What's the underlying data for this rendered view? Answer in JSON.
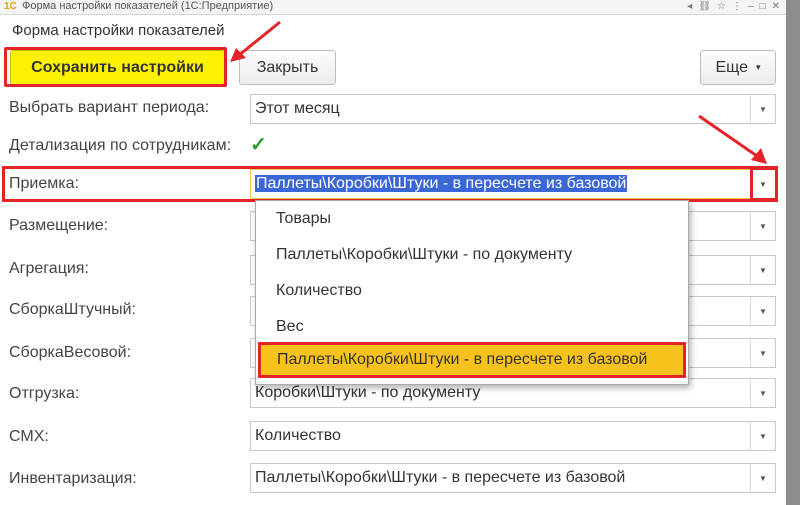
{
  "window": {
    "title": "Форма настройки показателей (1С:Предприятие)",
    "app_icon": "1c-logo-icon",
    "controls": [
      "back-icon",
      "link-icon",
      "star-icon",
      "menu-icon",
      "minimize-icon",
      "maximize-icon",
      "close-icon"
    ]
  },
  "form": {
    "title": "Форма настройки показателей"
  },
  "toolbar": {
    "save_label": "Сохранить настройки",
    "close_label": "Закрыть",
    "more_label": "Еще",
    "more_caret": "▾"
  },
  "fields": {
    "period": {
      "label": "Выбрать вариант периода:",
      "value": "Этот месяц"
    },
    "detail": {
      "label": "Детализация по сотрудникам:",
      "checked": true,
      "mark": "✓"
    },
    "priemka": {
      "label": "Приемка:",
      "value": "Паллеты\\Коробки\\Штуки - в пересчете из базовой"
    },
    "razmeshchenie": {
      "label": "Размещение:",
      "value": ""
    },
    "agregatsiya": {
      "label": "Агрегация:",
      "value": ""
    },
    "sborka_sht": {
      "label": "СборкаШтучный:",
      "value": ""
    },
    "sborka_ves": {
      "label": "СборкаВесовой:",
      "value": ""
    },
    "otgruzka": {
      "label": "Отгрузка:",
      "value": "Коробки\\Штуки - по документу"
    },
    "smh": {
      "label": "СМХ:",
      "value": "Количество"
    },
    "inventarizatsiya": {
      "label": "Инвентаризация:",
      "value": "Паллеты\\Коробки\\Штуки - в пересчете из базовой"
    }
  },
  "dropdown": {
    "options": [
      "Товары",
      "Паллеты\\Коробки\\Штуки - по документу",
      "Количество",
      "Вес",
      "Паллеты\\Коробки\\Штуки - в пересчете из базовой"
    ],
    "selected_index": 4
  },
  "colors": {
    "highlight": "#e5242a",
    "save_button": "#fff200",
    "selected_option": "#f6c21b",
    "text_selection": "#3b67d6"
  },
  "dropdown_caret": "▾"
}
